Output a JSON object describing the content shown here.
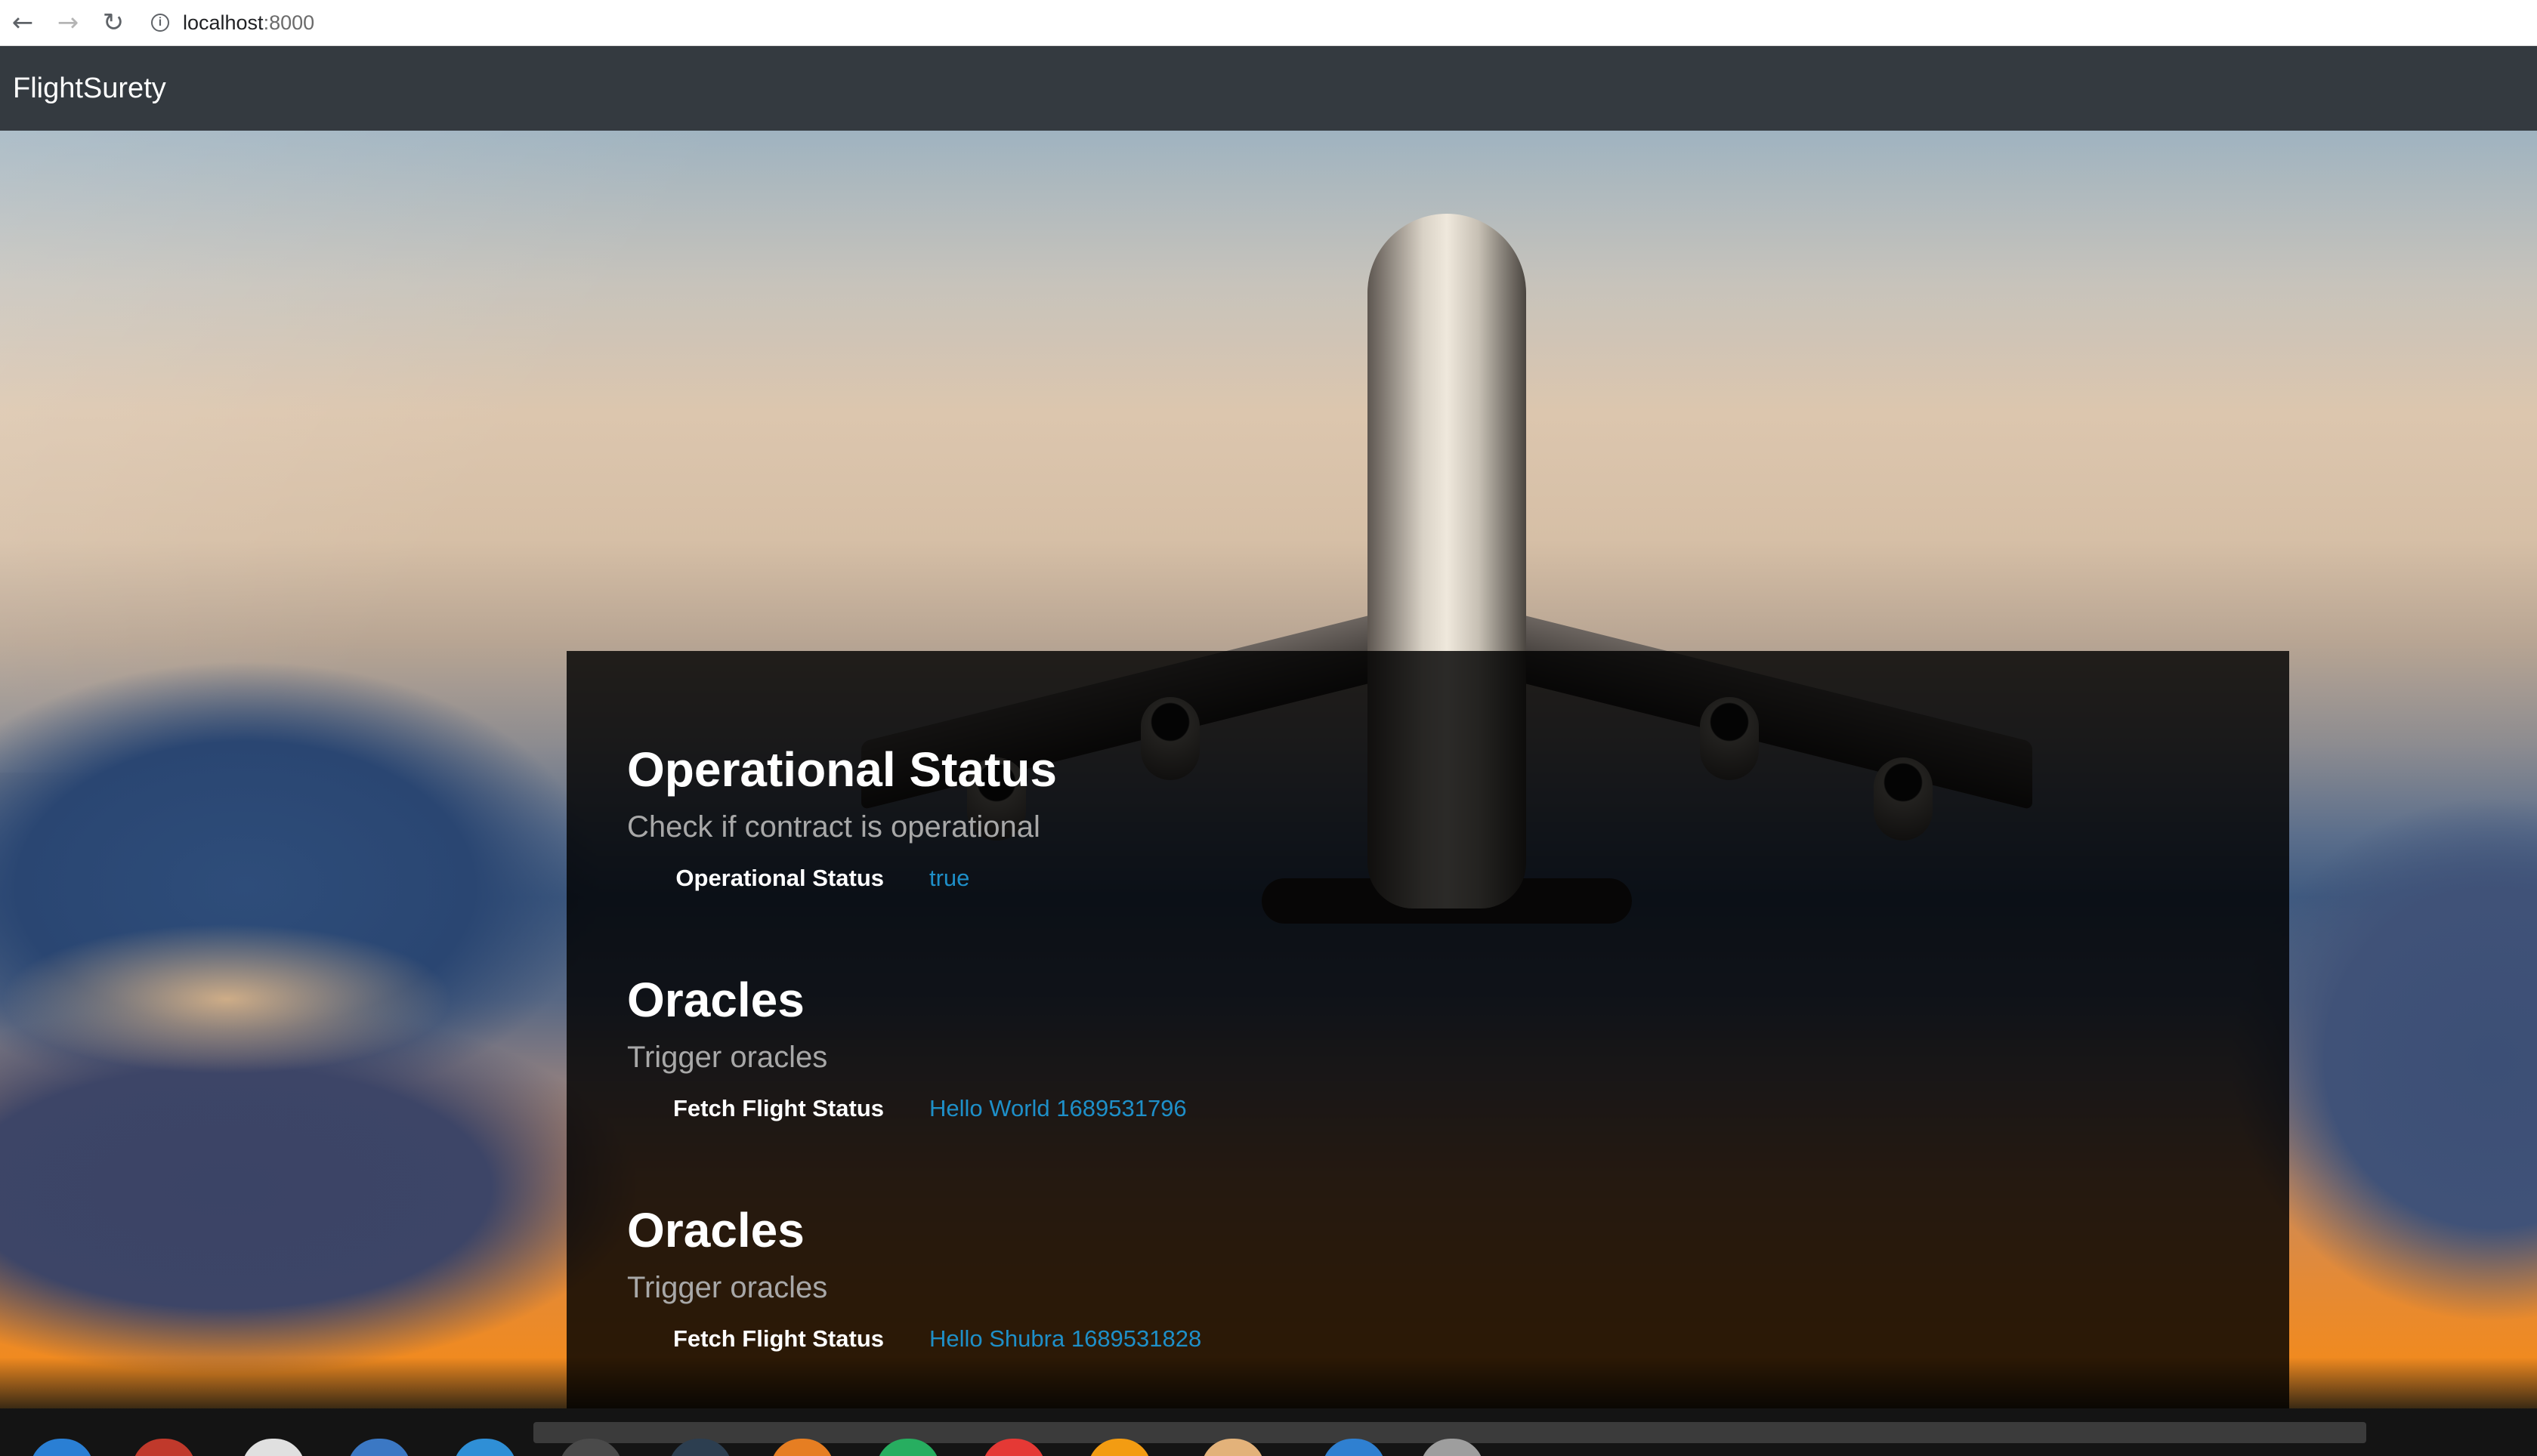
{
  "browser": {
    "back_icon": "←",
    "forward_icon": "→",
    "reload_icon": "↻",
    "info_icon": "i",
    "url_host": "localhost",
    "url_port": ":8000"
  },
  "navbar": {
    "brand": "FlightSurety"
  },
  "sections": [
    {
      "title": "Operational Status",
      "subtitle": "Check if contract is operational",
      "label": "Operational Status",
      "value": "true"
    },
    {
      "title": "Oracles",
      "subtitle": "Trigger oracles",
      "label": "Fetch Flight Status",
      "value": "Hello World 1689531796"
    },
    {
      "title": "Oracles",
      "subtitle": "Trigger oracles",
      "label": "Fetch Flight Status",
      "value": "Hello Shubra 1689531828"
    }
  ],
  "colors": {
    "navbar_bg": "#343a40",
    "value_link": "#1e8fc8",
    "subtitle": "#a8a8a8"
  },
  "taskbar": {
    "icons": [
      "firefox-icon",
      "files-icon",
      "camera-icon",
      "document-icon",
      "browser-icon",
      "terminal-icon",
      "monitor-icon",
      "text-editor-icon",
      "spreadsheet-icon",
      "chrome-icon",
      "vlc-icon",
      "package-icon",
      "vscode-icon",
      "disk-icon"
    ]
  }
}
